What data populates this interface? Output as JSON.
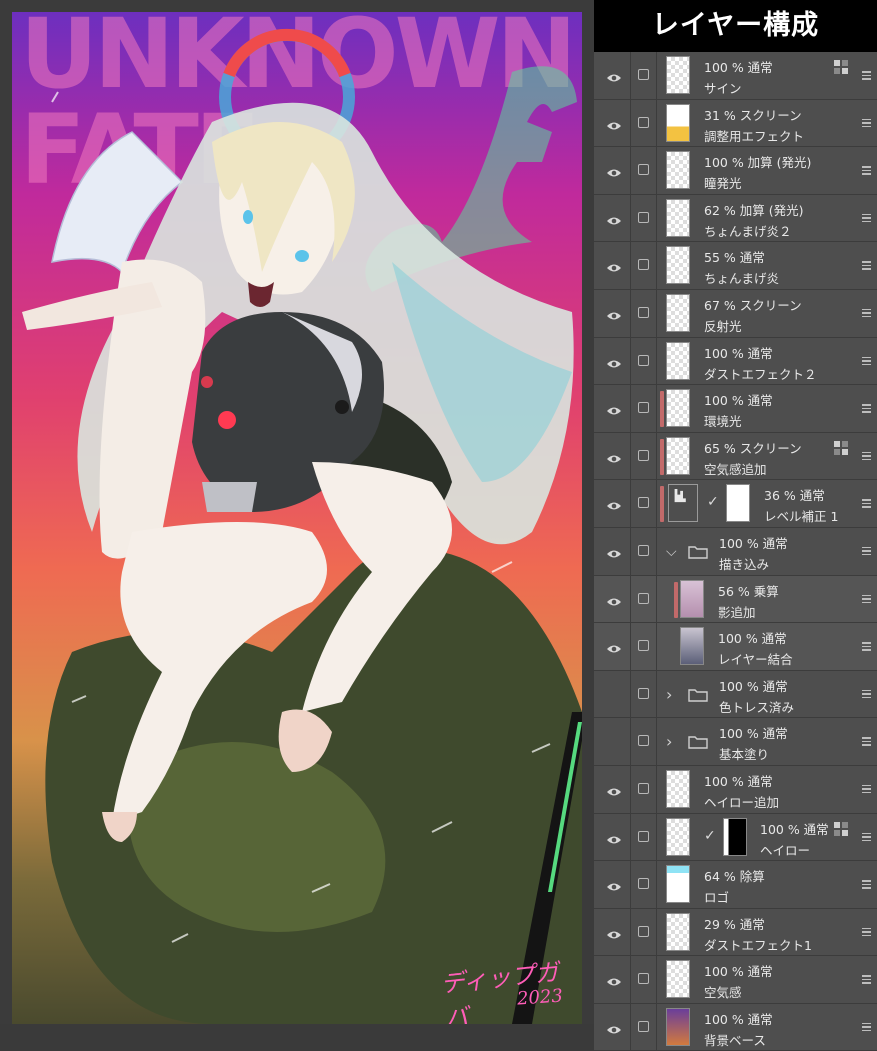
{
  "panel": {
    "title": "レイヤー構成"
  },
  "artwork": {
    "logo_line1": "UNKNOWN",
    "logo_line2": "FATE",
    "logo_letter": "F",
    "signature": "ディップガバ",
    "signature_year": "2023"
  },
  "layers": [
    {
      "opacity_mode": "100 % 通常",
      "name": "サイン",
      "visible": true,
      "lock": true
    },
    {
      "opacity_mode": "31 % スクリーン",
      "name": "調整用エフェクト",
      "visible": true
    },
    {
      "opacity_mode": "100 % 加算 (発光)",
      "name": "瞳発光",
      "visible": true
    },
    {
      "opacity_mode": "62 % 加算 (発光)",
      "name": "ちょんまげ炎２",
      "visible": true
    },
    {
      "opacity_mode": "55 % 通常",
      "name": "ちょんまげ炎",
      "visible": true
    },
    {
      "opacity_mode": "67 % スクリーン",
      "name": "反射光",
      "visible": true
    },
    {
      "opacity_mode": "100 % 通常",
      "name": "ダストエフェクト２",
      "visible": true
    },
    {
      "opacity_mode": "100 % 通常",
      "name": "環境光",
      "visible": true,
      "clipped": true
    },
    {
      "opacity_mode": "65 % スクリーン",
      "name": "空気感追加",
      "visible": true,
      "clipped": true,
      "lock": true
    },
    {
      "opacity_mode": "36 % 通常",
      "name": "レベル補正 1",
      "visible": true,
      "clipped": true,
      "adjustment": true
    },
    {
      "opacity_mode": "100 % 通常",
      "name": "描き込み",
      "visible": true,
      "folder": true,
      "expanded": true
    },
    {
      "opacity_mode": "56 % 乗算",
      "name": "影追加",
      "visible": true,
      "clipped": true,
      "child": true
    },
    {
      "opacity_mode": "100 % 通常",
      "name": "レイヤー結合",
      "visible": true,
      "child": true
    },
    {
      "opacity_mode": "100 % 通常",
      "name": "色トレス済み",
      "visible": false,
      "folder": true,
      "expanded": false
    },
    {
      "opacity_mode": "100 % 通常",
      "name": "基本塗り",
      "visible": false,
      "folder": true,
      "expanded": false
    },
    {
      "opacity_mode": "100 % 通常",
      "name": "ヘイロー追加",
      "visible": true
    },
    {
      "opacity_mode": "100 % 通常",
      "name": "ヘイロー",
      "visible": true,
      "mask": true,
      "lock": true
    },
    {
      "opacity_mode": "64 % 除算",
      "name": "ロゴ",
      "visible": true
    },
    {
      "opacity_mode": "29 % 通常",
      "name": "ダストエフェクト1",
      "visible": true
    },
    {
      "opacity_mode": "100 % 通常",
      "name": "空気感",
      "visible": true
    },
    {
      "opacity_mode": "100 % 通常",
      "name": "背景ベース",
      "visible": true
    }
  ],
  "colors": {
    "panel_bg": "#4e4e4e",
    "title_bg": "#000000",
    "clip_bar": "#c26a6a",
    "text": "#e8e8e8"
  }
}
